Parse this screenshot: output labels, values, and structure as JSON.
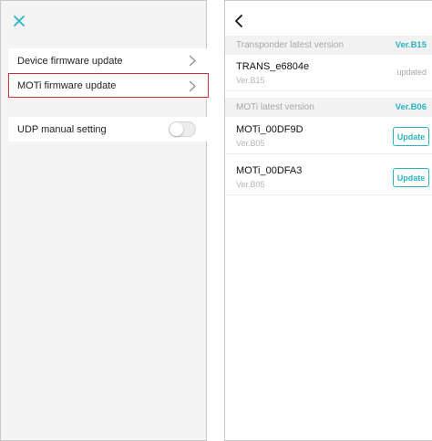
{
  "left": {
    "close_icon": "close-icon",
    "accent": "#2bb3c5",
    "rows": [
      {
        "label": "Device firmware update"
      },
      {
        "label": "MOTi firmware update"
      },
      {
        "label": "UDP manual setting"
      }
    ],
    "udp_toggle_on": false
  },
  "right": {
    "back_icon": "back-icon",
    "transponder_section": {
      "label": "Transponder latest version",
      "version": "Ver.B15"
    },
    "transponder": {
      "name": "TRANS_e6804e",
      "version": "Ver.B15",
      "status": "updated"
    },
    "moti_section": {
      "label": "MOTi latest version",
      "version": "Ver.B06"
    },
    "moti_devices": [
      {
        "name": "MOTi_00DF9D",
        "version": "Ver.B05",
        "action": "Update"
      },
      {
        "name": "MOTi_00DFA3",
        "version": "Ver.B05",
        "action": "Update"
      }
    ]
  }
}
